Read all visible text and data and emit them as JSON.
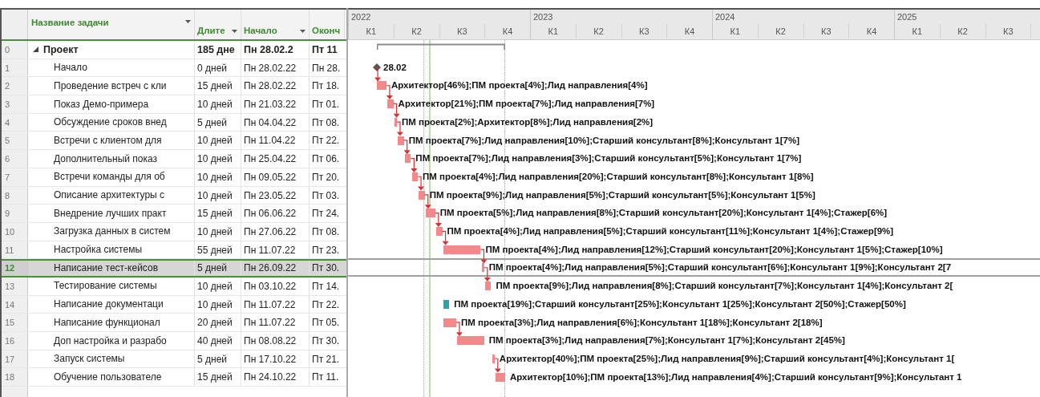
{
  "table": {
    "columns": [
      {
        "label": "Название задачи",
        "dropdown": true
      },
      {
        "label": "Длите",
        "dropdown": true
      },
      {
        "label": "Начало",
        "dropdown": true
      },
      {
        "label": "Оконч",
        "dropdown": false
      }
    ]
  },
  "timeline": {
    "years": [
      {
        "label": "2022",
        "quarters": [
          "К1",
          "К2",
          "К3",
          "К4"
        ]
      },
      {
        "label": "2023",
        "quarters": [
          "К1",
          "К2",
          "К3",
          "К4"
        ]
      },
      {
        "label": "2024",
        "quarters": [
          "К1",
          "К2",
          "К3",
          "К4"
        ]
      },
      {
        "label": "2025",
        "quarters": [
          "К1",
          "К2",
          "К3"
        ]
      }
    ]
  },
  "tasks": [
    {
      "num": "0",
      "name": "Проект",
      "duration": "185 дне",
      "start": "Пн 28.02.2",
      "finish": "Пт 11",
      "kind": "summary",
      "selected": false,
      "expanded": true,
      "children": [
        {
          "num": "1",
          "name": "Начало",
          "duration": "0 дней",
          "start": "Пн 28.02.22",
          "finish": "Пн 28.",
          "kind": "milestone",
          "selected": false,
          "linked": false,
          "color": "#555555",
          "label": "28.02"
        },
        {
          "num": "2",
          "name": "Проведение встреч с кли",
          "duration": "15 дней",
          "start": "Пн 28.02.22",
          "finish": "Пт 18.",
          "kind": "task",
          "selected": false,
          "linked": true,
          "color": "#f4898b",
          "label": "Архитектор[46%];ПМ проекта[4%];Лид направления[4%]"
        },
        {
          "num": "3",
          "name": "Показ Демо-примера",
          "duration": "10 дней",
          "start": "Пн 21.03.22",
          "finish": "Пт 01.",
          "kind": "task",
          "selected": false,
          "linked": true,
          "color": "#f4898b",
          "label": "Архитектор[21%];ПМ проекта[7%];Лид направления[7%]"
        },
        {
          "num": "4",
          "name": "Обсуждение сроков внед",
          "duration": "5 дней",
          "start": "Пн 04.04.22",
          "finish": "Пт 08.",
          "kind": "task",
          "selected": false,
          "linked": true,
          "color": "#f4898b",
          "label": "ПМ проекта[2%];Архитектор[8%];Лид направления[2%]"
        },
        {
          "num": "5",
          "name": "Встречи с клиентом для",
          "duration": "10 дней",
          "start": "Пн 11.04.22",
          "finish": "Пт 22.",
          "kind": "task",
          "selected": false,
          "linked": true,
          "color": "#f4898b",
          "label": "ПМ проекта[7%];Лид направления[10%];Старший консультант[8%];Консультант 1[7%]"
        },
        {
          "num": "6",
          "name": "Дополнительный показ",
          "duration": "10 дней",
          "start": "Пн 25.04.22",
          "finish": "Пт 06.",
          "kind": "task",
          "selected": false,
          "linked": true,
          "color": "#f4898b",
          "label": "ПМ проекта[7%];Лид направления[3%];Старший консультант[5%];Консультант 1[7%]"
        },
        {
          "num": "7",
          "name": "Встречи команды для об",
          "duration": "10 дней",
          "start": "Пн 09.05.22",
          "finish": "Пт 20.",
          "kind": "task",
          "selected": false,
          "linked": true,
          "color": "#f4898b",
          "label": "ПМ проекта[4%];Лид направления[20%];Старший консультант[8%];Консультант 1[8%]"
        },
        {
          "num": "8",
          "name": "Описание архитектуры с",
          "duration": "10 дней",
          "start": "Пн 23.05.22",
          "finish": "Пт 03.",
          "kind": "task",
          "selected": false,
          "linked": true,
          "color": "#f4898b",
          "label": "ПМ проекта[9%];Лид направления[5%];Старший консультант[5%];Консультант 1[5%]"
        },
        {
          "num": "9",
          "name": "Внедрение лучших практ",
          "duration": "15 дней",
          "start": "Пн 06.06.22",
          "finish": "Пт 24.",
          "kind": "task",
          "selected": false,
          "linked": true,
          "color": "#f4898b",
          "label": "ПМ проекта[5%];Лид направления[8%];Старший консультант[20%];Консультант 1[4%];Стажер[6%]"
        },
        {
          "num": "10",
          "name": "Загрузка данных в систем",
          "duration": "10 дней",
          "start": "Пн 27.06.22",
          "finish": "Пт 08.",
          "kind": "task",
          "selected": false,
          "linked": true,
          "color": "#f4898b",
          "label": "ПМ проекта[4%];Лид направления[5%];Старший консультант[11%];Консультант 1[4%];Стажер[9%]"
        },
        {
          "num": "11",
          "name": "Настройка системы",
          "duration": "55 дней",
          "start": "Пн 11.07.22",
          "finish": "Пт 23.",
          "kind": "task",
          "selected": false,
          "linked": true,
          "color": "#f4898b",
          "label": "ПМ проекта[4%];Лид направления[12%];Старший консультант[20%];Консультант 1[5%];Стажер[10%]"
        },
        {
          "num": "12",
          "name": "Написание тест-кейсов",
          "duration": "5 дней",
          "start": "Пн 26.09.22",
          "finish": "Пт 30.",
          "kind": "task",
          "selected": true,
          "linked": true,
          "color": "#f4898b",
          "label": "ПМ проекта[4%];Лид направления[5%];Старший консультант[6%];Консультант 1[9%];Консультант 2[7"
        },
        {
          "num": "13",
          "name": "Тестирование системы",
          "duration": "10 дней",
          "start": "Пн 03.10.22",
          "finish": "Пт 14.",
          "kind": "task",
          "selected": false,
          "linked": true,
          "color": "#f4898b",
          "label": "ПМ проекта[9%];Лид направления[8%];Старший консультант[7%];Консультант 1[4%];Консультант 2["
        },
        {
          "num": "14",
          "name": "Написание документаци",
          "duration": "10 дней",
          "start": "Пн 11.07.22",
          "finish": "Пт 22.",
          "kind": "task",
          "selected": false,
          "linked": false,
          "color": "#2ba3aa",
          "label": "ПМ проекта[19%];Старший консультант[25%];Консультант 1[25%];Консультант 2[50%];Стажер[50%]"
        },
        {
          "num": "15",
          "name": "Написание функционал",
          "duration": "20 дней",
          "start": "Пн 11.07.22",
          "finish": "Пт 05.",
          "kind": "task",
          "selected": false,
          "linked": false,
          "color": "#f4898b",
          "label": "ПМ проекта[3%];Лид направления[6%];Консультант 1[18%];Консультант 2[18%]"
        },
        {
          "num": "16",
          "name": "Доп настройка и разрабо",
          "duration": "40 дней",
          "start": "Пн 08.08.22",
          "finish": "Пт 30.",
          "kind": "task",
          "selected": false,
          "linked": true,
          "color": "#f4898b",
          "label": "ПМ проекта[3%];Лид направления[7%];Консультант 1[7%];Консультант 2[45%]"
        },
        {
          "num": "17",
          "name": "Запуск системы",
          "duration": "5 дней",
          "start": "Пн 17.10.22",
          "finish": "Пт 21.",
          "kind": "task",
          "selected": false,
          "linked": false,
          "color": "#f4898b",
          "label": "Архитектор[40%];ПМ проекта[25%];Лид направления[9%];Старший консультант[4%];Консультант 1["
        },
        {
          "num": "18",
          "name": "Обучение пользователе",
          "duration": "15 дней",
          "start": "Пн 24.10.22",
          "finish": "Пт 11.",
          "kind": "task",
          "selected": false,
          "linked": true,
          "color": "#f4898b",
          "label": "Архитектор[10%];ПМ проекта[13%];Лид направления[4%];Старший консультант[9%];Консультант 1"
        }
      ]
    }
  ]
}
